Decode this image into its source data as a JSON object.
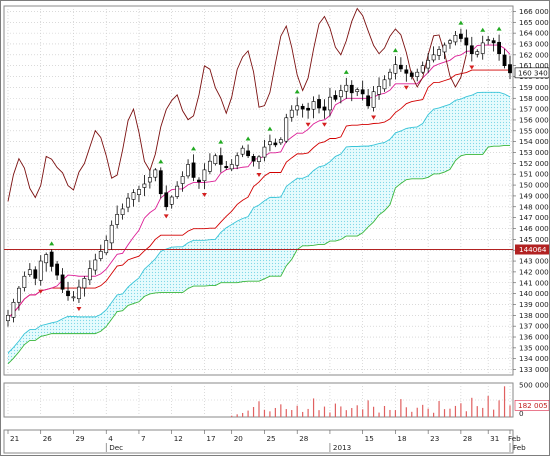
{
  "chart_data": [
    {
      "type": "line",
      "subtype": "candlestick-ichimoku",
      "title": "",
      "xlabel": "",
      "ylabel": "",
      "ylim": [
        132500,
        166500
      ],
      "grid": true,
      "y_ticks": [
        "133 000",
        "134 000",
        "135 000",
        "136 000",
        "137 000",
        "138 000",
        "139 000",
        "140 000",
        "141 000",
        "142 000",
        "143 000",
        "144 000",
        "145 000",
        "146 000",
        "147 000",
        "148 000",
        "149 000",
        "150 000",
        "151 000",
        "152 000",
        "153 000",
        "154 000",
        "155 000",
        "156 000",
        "157 000",
        "158 000",
        "159 000",
        "160 000",
        "161 000",
        "162 000",
        "163 000",
        "164 000",
        "165 000",
        "166 000"
      ],
      "x_tick_labels": [
        "21",
        "26",
        "29",
        "4",
        "7",
        "12",
        "17",
        "20",
        "25",
        "28",
        "2013",
        "15",
        "18",
        "23",
        "28",
        "31",
        "Feb"
      ],
      "x_month_labels": [
        "Dec",
        "2013",
        "Feb"
      ],
      "current_value_label": "160 340",
      "horizontal_line_label": "144064",
      "horizontal_line_value": 144064,
      "colors": {
        "up_candle": "#000000",
        "down_candle": "#000000",
        "tenkan": "#dc1e96",
        "kijun": "#d20000",
        "chikou": "#7b1010",
        "span_a": "#38c4d8",
        "span_b": "#39b639",
        "cloud_fill": "#7fd8e8",
        "level_line": "#b22222",
        "arrow_up": "#22aa22",
        "arrow_down": "#d42020",
        "volume": "#e06060"
      },
      "series": [
        {
          "name": "",
          "values": [
            138000,
            139200,
            140500,
            141600,
            142200,
            141400,
            143000,
            143600,
            142500,
            141700,
            140400,
            139800,
            139700,
            140600,
            141400,
            142300,
            143100,
            143900,
            144900,
            146300,
            147300,
            147800,
            148800,
            149300,
            149600,
            150100,
            150700,
            151400,
            149200,
            148000,
            148900,
            149900,
            150800,
            151900,
            150700,
            150300,
            151400,
            152200,
            152700,
            151900,
            151600,
            151900,
            152700,
            153400,
            152700,
            152200,
            152600,
            153500,
            154000,
            153700,
            154200,
            156200,
            156900,
            157300,
            157000,
            156900,
            157700,
            157100,
            156900,
            158100,
            157900,
            158700,
            159200,
            158500,
            158800,
            158400,
            157300,
            158600,
            159100,
            159700,
            160400,
            161100,
            160700,
            160300,
            160000,
            160400,
            161000,
            161500,
            162000,
            162500,
            162900,
            163300,
            163800,
            163500,
            162900,
            162100,
            162300,
            163100,
            163400,
            163100,
            162100,
            161000,
            160340
          ]
        }
      ]
    },
    {
      "type": "bar",
      "title": "",
      "y_ticks": [
        "500 000",
        "0"
      ],
      "current_value_label": "182 005",
      "values": [
        0,
        0,
        0,
        0,
        0,
        0,
        0,
        0,
        0,
        0,
        0,
        0,
        0,
        0,
        0,
        0,
        0,
        0,
        0,
        0,
        0,
        0,
        0,
        0,
        0,
        0,
        0,
        0,
        0,
        0,
        0,
        0,
        0,
        0,
        0,
        0,
        0,
        0,
        0,
        0,
        0,
        20000,
        42000,
        63000,
        100000,
        156000,
        246000,
        113000,
        88000,
        141000,
        198000,
        124000,
        109000,
        177000,
        79000,
        126000,
        290000,
        107000,
        163000,
        71000,
        210000,
        165000,
        107000,
        140000,
        183000,
        120000,
        260000,
        160000,
        69000,
        172000,
        110000,
        108000,
        280000,
        152000,
        81000,
        145000,
        190000,
        131000,
        66000,
        250000,
        123000,
        130000,
        173000,
        215000,
        90000,
        300000,
        170000,
        142000,
        330000,
        115000,
        260000,
        480000,
        182005
      ]
    }
  ]
}
